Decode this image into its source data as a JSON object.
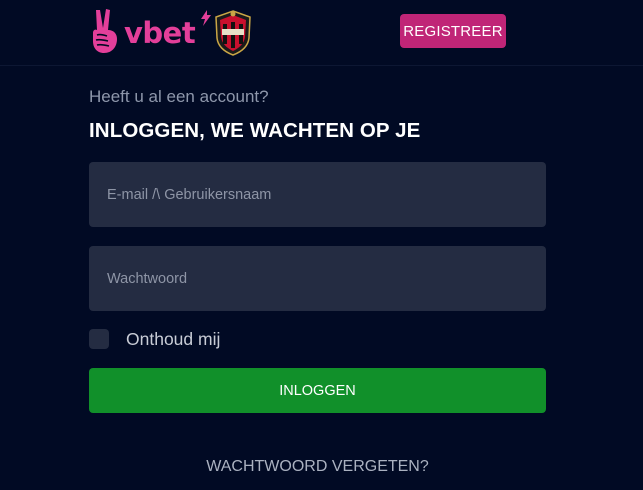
{
  "header": {
    "brand_name": "vbet",
    "register_label": "REGISTREER"
  },
  "form": {
    "subheading": "Heeft u al een account?",
    "title": "INLOGGEN, WE WACHTEN OP JE",
    "email_placeholder": "E-mail /\\ Gebruikersnaam",
    "email_value": "",
    "password_placeholder": "Wachtwoord",
    "password_value": "",
    "remember_label": "Onthoud mij",
    "remember_checked": false,
    "login_label": "INLOGGEN",
    "forgot_label": "WACHTWOORD VERGETEN?"
  },
  "colors": {
    "background": "#010a24",
    "brand_pink": "#e33f9a",
    "register_button": "#c02577",
    "input_background": "#242c42",
    "login_button": "#11902a"
  },
  "icons": [
    "peace-hand-icon",
    "bolt-icon",
    "club-crest-icon"
  ]
}
